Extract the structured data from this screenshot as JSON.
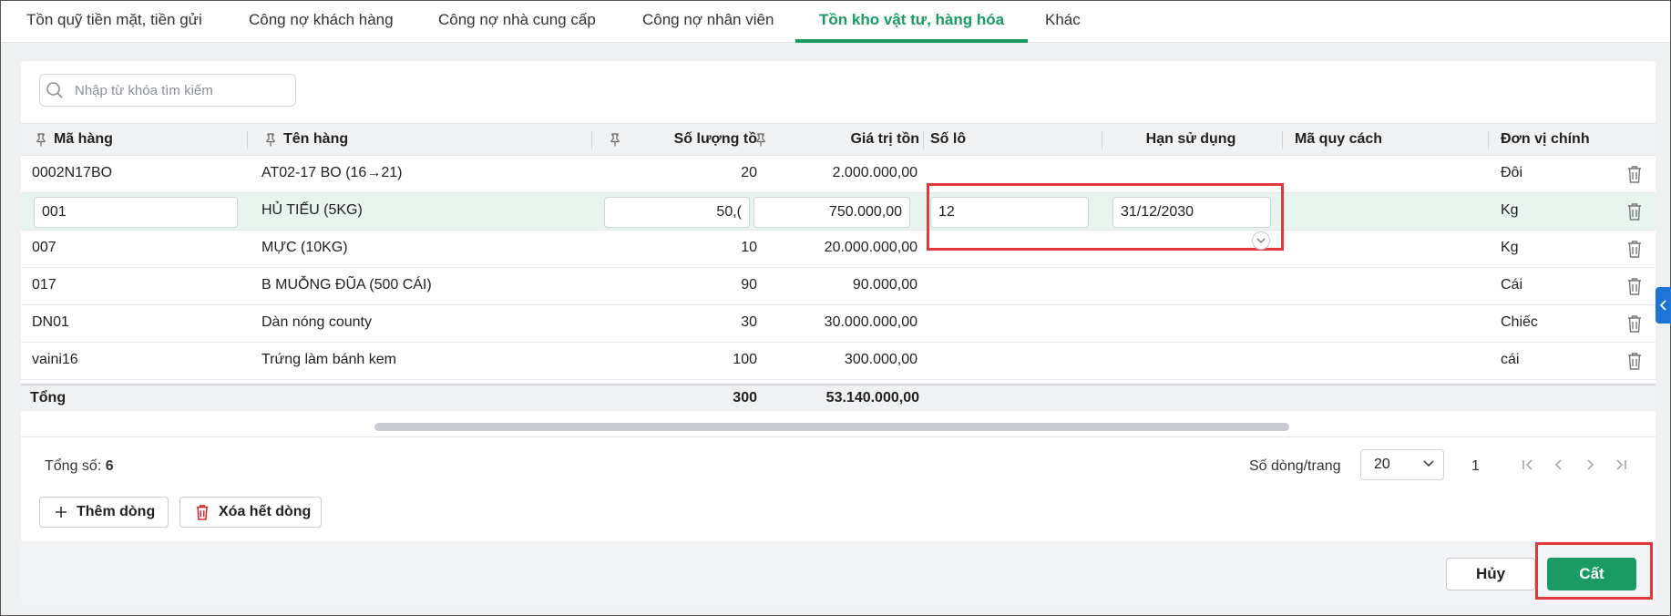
{
  "tabs": [
    {
      "label": "Tồn quỹ tiền mặt, tiền gửi"
    },
    {
      "label": "Công nợ khách hàng"
    },
    {
      "label": "Công nợ nhà cung cấp"
    },
    {
      "label": "Công nợ nhân viên"
    },
    {
      "label": "Tồn kho vật tư, hàng hóa",
      "active": true
    },
    {
      "label": "Khác"
    }
  ],
  "search": {
    "placeholder": "Nhập từ khóa tìm kiếm"
  },
  "columns": {
    "ma_hang": "Mã hàng",
    "ten_hang": "Tên hàng",
    "so_luong": "Số lượng tồ",
    "gia_tri": "Giá trị tồn",
    "so_lo": "Số lô",
    "han_su_dung": "Hạn sử dụng",
    "ma_quy_cach": "Mã quy cách",
    "don_vi": "Đơn vị chính"
  },
  "rows": [
    {
      "ma_hang": "0002N17BO",
      "ten_hang": "AT02-17 BO (16→21)",
      "so_luong": "20",
      "gia_tri": "2.000.000,00",
      "so_lo": "",
      "han_su_dung": "",
      "ma_quy_cach": "",
      "don_vi": "Đôi"
    },
    {
      "ma_hang": "001",
      "ten_hang": "HỦ TIẾU (5KG)",
      "so_luong": "50,(",
      "gia_tri": "750.000,00",
      "so_lo": "12",
      "han_su_dung": "31/12/2030",
      "ma_quy_cach": "",
      "don_vi": "Kg"
    },
    {
      "ma_hang": "007",
      "ten_hang": "MỰC (10KG)",
      "so_luong": "10",
      "gia_tri": "20.000.000,00",
      "so_lo": "",
      "han_su_dung": "",
      "ma_quy_cach": "",
      "don_vi": "Kg"
    },
    {
      "ma_hang": "017",
      "ten_hang": "B MUỖNG ĐŨA (500 CÁI)",
      "so_luong": "90",
      "gia_tri": "90.000,00",
      "so_lo": "",
      "han_su_dung": "",
      "ma_quy_cach": "",
      "don_vi": "Cái"
    },
    {
      "ma_hang": "DN01",
      "ten_hang": "Dàn nóng county",
      "so_luong": "30",
      "gia_tri": "30.000.000,00",
      "so_lo": "",
      "han_su_dung": "",
      "ma_quy_cach": "",
      "don_vi": "Chiếc"
    },
    {
      "ma_hang": "vaini16",
      "ten_hang": "Trứng làm bánh kem",
      "so_luong": "100",
      "gia_tri": "300.000,00",
      "so_lo": "",
      "han_su_dung": "",
      "ma_quy_cach": "",
      "don_vi": "cái"
    }
  ],
  "totals": {
    "label": "Tổng",
    "so_luong": "300",
    "gia_tri": "53.140.000,00"
  },
  "footer": {
    "count_label": "Tổng số:",
    "count_value": "6",
    "rows_per_page_label": "Số dòng/trang",
    "rows_per_page_value": "20",
    "page": "1"
  },
  "actions": {
    "add_row": "Thêm dòng",
    "delete_all": "Xóa hết dòng",
    "cancel": "Hủy",
    "save": "Cất"
  },
  "colors": {
    "accent": "#1a9b63",
    "highlight": "#e0383b",
    "delete": "#d9262b"
  }
}
